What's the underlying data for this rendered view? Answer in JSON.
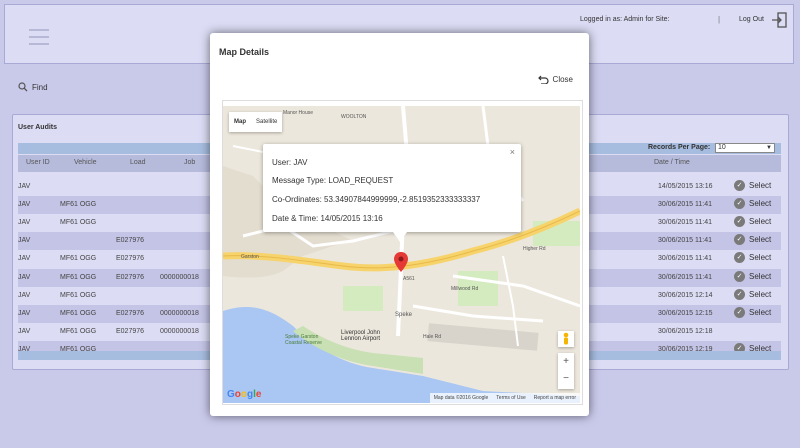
{
  "header": {
    "logged_in": "Logged in as: Admin for Site:",
    "separator": "|",
    "logout": "Log Out"
  },
  "find": {
    "label": "Find"
  },
  "audits": {
    "title": "User Audits",
    "records_per_page_label": "Records Per Page:",
    "records_per_page_value": "10",
    "columns": {
      "user_id": "User ID",
      "vehicle": "Vehicle",
      "load": "Load",
      "job": "Job",
      "datetime": "Date / Time"
    },
    "select_label": "Select",
    "rows": [
      {
        "user": "JAV",
        "vehicle": "",
        "load": "",
        "job": "",
        "date": "14/05/2015 13:16",
        "select": true
      },
      {
        "user": "JAV",
        "vehicle": "MF61 OGG",
        "load": "",
        "job": "",
        "date": "30/06/2015 11:41",
        "select": true
      },
      {
        "user": "JAV",
        "vehicle": "MF61 OGG",
        "load": "",
        "job": "",
        "date": "30/06/2015 11:41",
        "select": true
      },
      {
        "user": "JAV",
        "vehicle": "",
        "load": "E027976",
        "job": "",
        "date": "30/06/2015 11:41",
        "select": true
      },
      {
        "user": "JAV",
        "vehicle": "MF61 OGG",
        "load": "E027976",
        "job": "",
        "date": "30/06/2015 11:41",
        "select": true
      },
      {
        "user": "JAV",
        "vehicle": "MF61 OGG",
        "load": "E027976",
        "job": "0000000018",
        "date": "30/06/2015 11:41",
        "select": true
      },
      {
        "user": "JAV",
        "vehicle": "MF61 OGG",
        "load": "",
        "job": "",
        "date": "30/06/2015 12:14",
        "select": true
      },
      {
        "user": "JAV",
        "vehicle": "MF61 OGG",
        "load": "E027976",
        "job": "0000000018",
        "date": "30/06/2015 12:15",
        "select": true
      },
      {
        "user": "JAV",
        "vehicle": "MF61 OGG",
        "load": "E027976",
        "job": "0000000018",
        "date": "30/06/2015 12:18",
        "select": false
      },
      {
        "user": "JAV",
        "vehicle": "MF61 OGG",
        "load": "",
        "job": "",
        "date": "30/06/2015 12:19",
        "select": true
      }
    ]
  },
  "modal": {
    "title": "Map Details",
    "close_label": "Close",
    "map_types": [
      "Map",
      "Satellite"
    ],
    "info": {
      "user": "User: JAV",
      "message_type": "Message Type: LOAD_REQUEST",
      "coordinates": "Co-Ordinates: 53.34907844999999,-2.8519352333333337",
      "datetime": "Date & Time: 14/05/2015 13:16"
    },
    "map_labels": {
      "garston": "Garston",
      "speke": "Speke",
      "airport": "Liverpool John Lennon Airport",
      "reserve": "Speke Garston Coastal Reserve",
      "a561": "A561",
      "woolton": "WOOLTON",
      "manor": "Manor House",
      "halerd": "Hale Rd",
      "millwood": "Millwood Rd",
      "higher": "Higher Rd"
    },
    "attribution": [
      "Map data ©2016 Google",
      "Terms of Use",
      "Report a map error"
    ],
    "google_logo": "Google",
    "zoom_in": "+",
    "zoom_out": "−"
  },
  "colors": {
    "background": "#c9c9ea",
    "panel": "#dcdcf5",
    "marker": "#e53935"
  }
}
